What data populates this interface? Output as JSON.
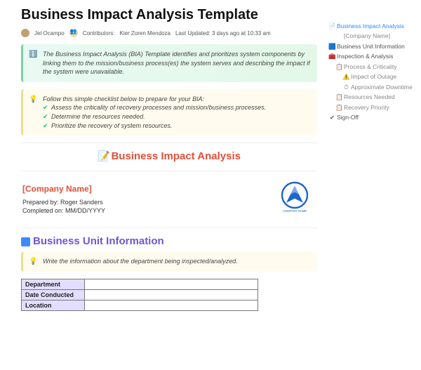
{
  "title": "Business Impact Analysis Template",
  "meta": {
    "author": "Jel Ocampo",
    "contributors_label": "Contributors:",
    "contributor": "Kier Zoren Mendoza",
    "last_updated": "Last Updated: 3 days ago at 10:33 am"
  },
  "callout_intro": "The Business Impact Analysis (BIA) Template identifies and prioritizes system components by linking them to the mission/business process(es) the system serves and describing the impact if the system were unavailable.",
  "checklist_lead": "Follow this simple checklist below to prepare for your BIA:",
  "checklist": [
    "Assess the criticality of recovery processes and mission/business processes.",
    "Determine the resources needed.",
    "Prioritize the recovery of system resources."
  ],
  "section1_title": "Business Impact Analysis",
  "company": {
    "name": "[Company Name]",
    "prepared": "Prepared by: Roger Sanders",
    "completed": "Completed on: MM/DD/YYYY",
    "logo_text": "COMPANY NAME"
  },
  "section2_title": "Business Unit Information",
  "callout_bui": "Write the information about the department being inspected/analyzed.",
  "table_rows": [
    "Department",
    "Date Conducted",
    "Location"
  ],
  "sidebar": {
    "items": [
      {
        "icon": "📄",
        "label": "Business Impact Analysis",
        "level": 0,
        "cls": "sb-active"
      },
      {
        "icon": "",
        "label": "[Company Name]",
        "level": 1,
        "cls": ""
      },
      {
        "icon": "🟦",
        "label": "Business Unit Information",
        "level": 0,
        "cls": "sb-strong"
      },
      {
        "icon": "🧰",
        "label": "Inspection & Analysis",
        "level": 0,
        "cls": "sb-strong"
      },
      {
        "icon": "📋",
        "label": "Process & Criticality",
        "level": 1,
        "cls": ""
      },
      {
        "icon": "⚠️",
        "label": "Impact of Outage",
        "level": 2,
        "cls": ""
      },
      {
        "icon": "⏱",
        "label": "Approximate Downtime",
        "level": 2,
        "cls": ""
      },
      {
        "icon": "📋",
        "label": "Resources Needed",
        "level": 1,
        "cls": ""
      },
      {
        "icon": "📋",
        "label": "Recovery Priority",
        "level": 1,
        "cls": ""
      },
      {
        "icon": "✔",
        "label": "Sign-Off",
        "level": 0,
        "cls": "sb-strong"
      }
    ]
  }
}
